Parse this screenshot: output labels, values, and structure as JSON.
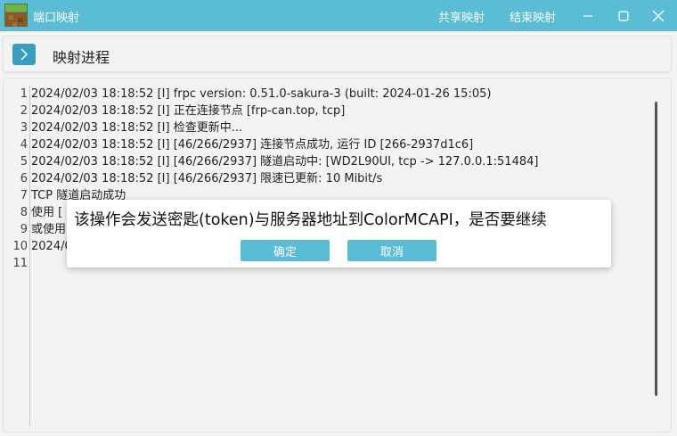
{
  "titlebar": {
    "title": "端口映射",
    "share_label": "共享映射",
    "stop_label": "结束映射"
  },
  "header": {
    "title": "映射进程"
  },
  "log": {
    "line_numbers": [
      "1",
      "2",
      "3",
      "4",
      "5",
      "6",
      "7",
      "8",
      "9",
      "10",
      "11"
    ],
    "lines": [
      "2024/02/03 18:18:52 [I] frpc version: 0.51.0-sakura-3 (built: 2024-01-26 15:05)",
      "2024/02/03 18:18:52 [I] 正在连接节点 [frp-can.top, tcp]",
      "2024/02/03 18:18:52 [I] 检查更新中...",
      "2024/02/03 18:18:52 [I] [46/266/2937] 连接节点成功, 运行 ID [266-2937d1c6]",
      "2024/02/03 18:18:52 [I] [46/266/2937] 隧道启动中: [WD2L90UI, tcp -> 127.0.0.1:51484]",
      "2024/02/03 18:18:52 [I] [46/266/2937] 限速已更新: 10 Mibit/s",
      "TCP 隧道启动成功",
      "使用 [",
      "或使用",
      "2024/0",
      ""
    ]
  },
  "dialog": {
    "message": "该操作会发送密匙(token)与服务器地址到ColorMCAPI，是否要继续",
    "confirm_label": "确定",
    "cancel_label": "取消"
  },
  "colors": {
    "accent": "#5bbcd6",
    "expand_button": "#3a9ec1"
  }
}
